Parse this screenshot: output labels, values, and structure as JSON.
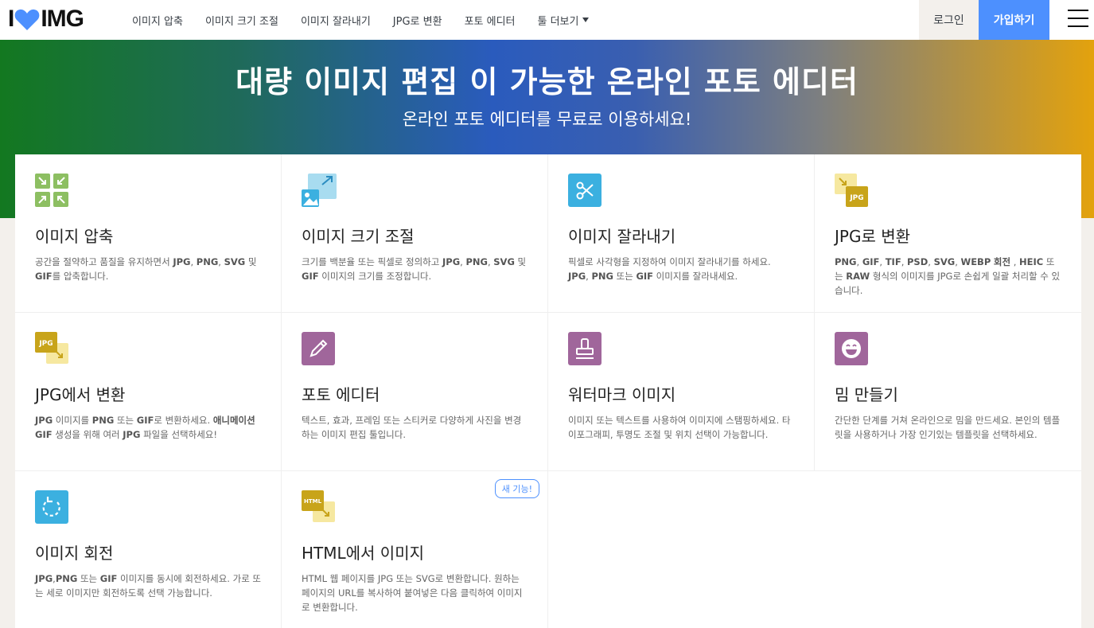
{
  "header": {
    "logo_left": "I",
    "logo_right": "IMG",
    "nav": [
      "이미지 압축",
      "이미지 크기 조절",
      "이미지 잘라내기",
      "JPG로 변환",
      "포토 에디터",
      "툴 더보기"
    ],
    "login": "로그인",
    "signup": "가입하기"
  },
  "hero": {
    "title": "대량 이미지 편집 이 가능한 온라인 포토 에디터",
    "subtitle": "온라인 포토 에디터를 무료로 이용하세요!"
  },
  "tools": [
    {
      "title": "이미지 압축",
      "desc_html": "공간을 절약하고 품질을 유지하면서 <b>JPG</b>, <b>PNG</b>, <b>SVG</b> 및 <b>GIF</b>를 압축합니다.",
      "icon": "compress-icon"
    },
    {
      "title": "이미지 크기 조절",
      "desc_html": "크기를 백분율 또는 픽셀로 정의하고 <b>JPG</b>, <b>PNG</b>, <b>SVG</b> 및 <b>GIF</b> 이미지의 크기를 조정합니다.",
      "icon": "resize-icon"
    },
    {
      "title": "이미지 잘라내기",
      "desc_html": "픽셀로 사각형을 지정하여 이미지 잘라내기를 하세요. <b>JPG</b>, <b>PNG</b> 또는 <b>GIF</b> 이미지를 잘라내세요.",
      "icon": "scissors-icon"
    },
    {
      "title": "JPG로 변환",
      "desc_html": "<b>PNG</b>, <b>GIF</b>, <b>TIF</b>, <b>PSD</b>, <b>SVG</b>, <b>WEBP</b> <b>회전</b> , <b>HEIC</b> 또는 <b>RAW</b> 형식의 이미지를 JPG로 손쉽게 일괄 처리할 수 있습니다.",
      "icon": "to-jpg-icon"
    },
    {
      "title": "JPG에서 변환",
      "desc_html": "<b>JPG</b> 이미지를 <b>PNG</b> 또는 <b>GIF</b>로 변환하세요. <b>애니메이션 GIF</b> 생성을 위해 여러 <b>JPG</b> 파일을 선택하세요!",
      "icon": "from-jpg-icon"
    },
    {
      "title": "포토 에디터",
      "desc_html": "텍스트, 효과, 프레임 또는 스티커로 다양하게 사진을 변경하는 이미지 편집 툴입니다.",
      "icon": "pencil-icon"
    },
    {
      "title": "워터마크 이미지",
      "desc_html": "이미지 또는 텍스트를 사용하여 이미지에 스탬핑하세요. 타이포그래피, 투명도 조절 및 위치 선택이 가능합니다.",
      "icon": "stamp-icon"
    },
    {
      "title": "밈 만들기",
      "desc_html": "간단한 단계를 거쳐 온라인으로 밈을 만드세요. 본인의 템플릿을 사용하거나 가장 인기있는 템플릿을 선택하세요.",
      "icon": "laugh-icon"
    },
    {
      "title": "이미지 회전",
      "desc_html": "<b>JPG</b>,<b>PNG</b> 또는 <b>GIF</b> 이미지를 동시에 회전하세요. 가로 또는 세로 이미지만 회전하도록 선택 가능합니다.",
      "icon": "rotate-icon"
    },
    {
      "title": "HTML에서 이미지",
      "desc_html": "HTML 웹 페이지를 JPG 또는 SVG로 변환합니다. 원하는 페이지의 URL를 복사하여 붙여넣은 다음 클릭하여 이미지로 변환합니다.",
      "icon": "html-icon",
      "badge": "새 기능!"
    }
  ],
  "icon_labels": {
    "jpg": "JPG",
    "html": "HTML"
  },
  "colors": {
    "accent": "#4d90fe",
    "compress": "#8dbf62",
    "resize": "#3bb0e0",
    "crop": "#3bb0e0",
    "jpg": "#c8a41a",
    "editor": "#a0669b",
    "rotate": "#3bb0e0"
  }
}
